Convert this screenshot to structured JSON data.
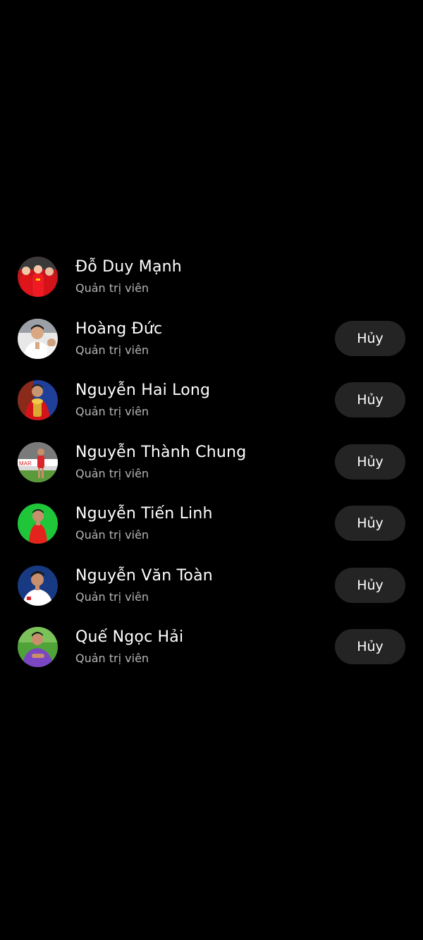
{
  "members": [
    {
      "name": "Đỗ Duy Mạnh",
      "role": "Quản trị viên",
      "action": null,
      "avatar": {
        "icon": "team-photo-avatar",
        "bg": "#c2181d",
        "accent": "#f2c8a8",
        "shirt": "#e0141b"
      }
    },
    {
      "name": "Hoàng Đức",
      "role": "Quản trị viên",
      "action": "Hủy",
      "avatar": {
        "icon": "person-avatar",
        "bg": "#e8e8e8",
        "accent": "#d9a882",
        "shirt": "#ffffff"
      }
    },
    {
      "name": "Nguyễn Hai Long",
      "role": "Quản trị viên",
      "action": "Hủy",
      "avatar": {
        "icon": "trophy-avatar",
        "bg": "#1f3f9a",
        "accent": "#c89670",
        "shirt": "#d3141a"
      }
    },
    {
      "name": "Nguyễn Thành Chung",
      "role": "Quản trị viên",
      "action": "Hủy",
      "avatar": {
        "icon": "stadium-avatar",
        "bg": "#d9d9d9",
        "accent": "#c98f6c",
        "shirt": "#d8262b"
      }
    },
    {
      "name": "Nguyễn Tiến Linh",
      "role": "Quản trị viên",
      "action": "Hủy",
      "avatar": {
        "icon": "person-avatar",
        "bg": "#20c63a",
        "accent": "#c98f6c",
        "shirt": "#e4231d"
      }
    },
    {
      "name": "Nguyễn Văn Toàn",
      "role": "Quản trị viên",
      "action": "Hủy",
      "avatar": {
        "icon": "person-avatar",
        "bg": "#173a82",
        "accent": "#c98f6c",
        "shirt": "#ffffff"
      }
    },
    {
      "name": "Quế Ngọc Hải",
      "role": "Quản trị viên",
      "action": "Hủy",
      "avatar": {
        "icon": "person-avatar",
        "bg": "#4fa338",
        "accent": "#c98f6c",
        "shirt": "#7b46c2"
      }
    }
  ],
  "colors": {
    "background": "#000000",
    "button": "#242424",
    "subtitle": "#b5b5b5"
  }
}
